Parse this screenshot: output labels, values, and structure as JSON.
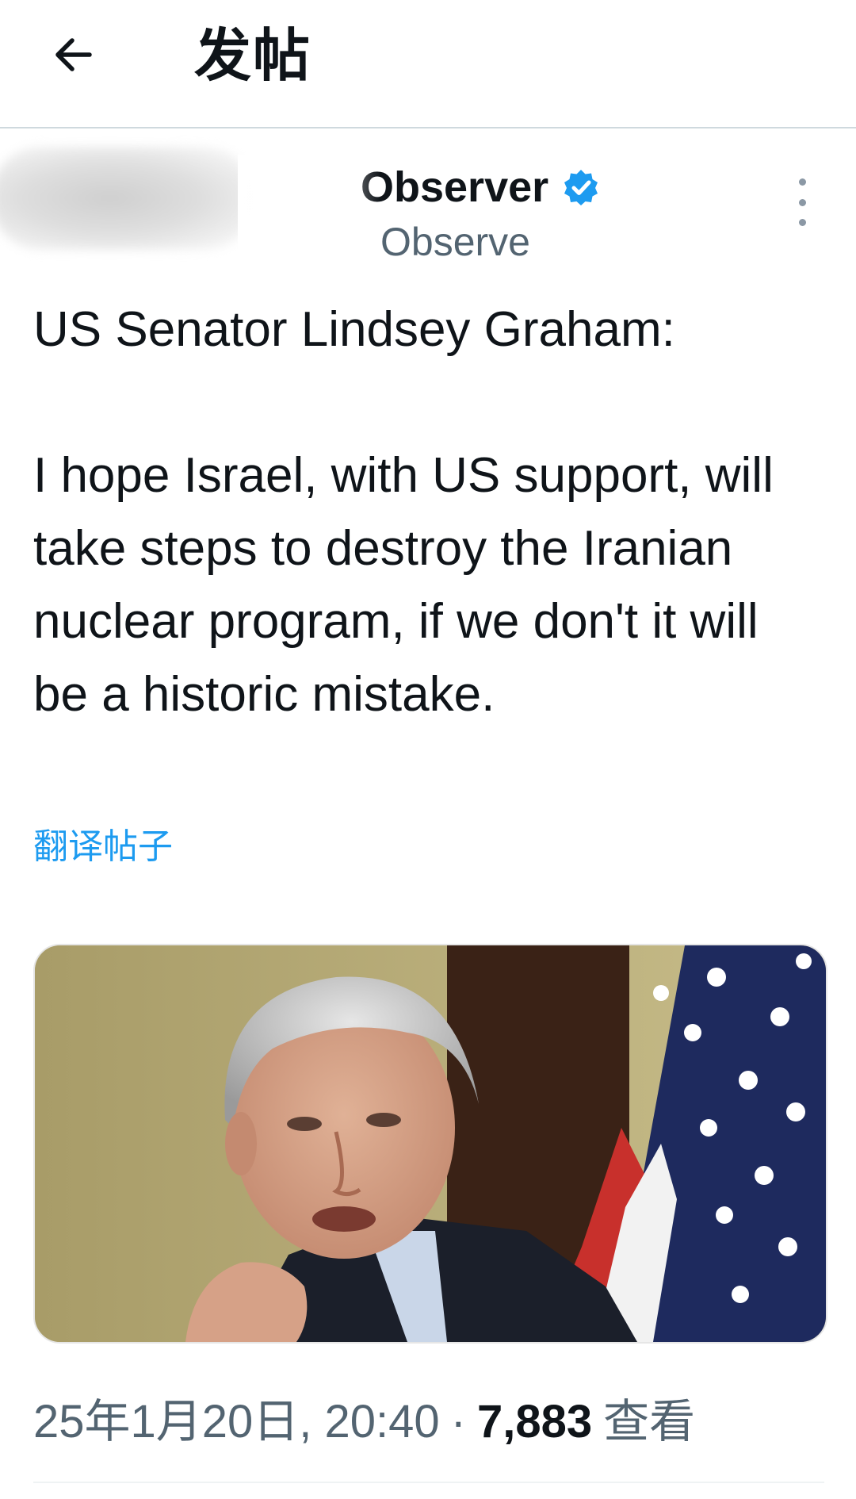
{
  "header": {
    "title": "发帖",
    "back_icon": "arrow-left-icon"
  },
  "author": {
    "display_name": "Observer",
    "handle": "Observe",
    "verified_icon": "verified-badge-icon",
    "verified_color": "#1d9bf0",
    "more_icon": "more-vertical-icon"
  },
  "post": {
    "text": "US Senator Lindsey Graham:\n\nI hope Israel, with US support, will take steps to destroy the Iranian nuclear program, if we don't it will be a historic mistake.",
    "translate_label": "翻译帖子",
    "link_color": "#1d9bf0"
  },
  "meta": {
    "timestamp": "25年1月20日, 20:40",
    "separator": "·",
    "views_count": "7,883",
    "views_label": "查看"
  }
}
